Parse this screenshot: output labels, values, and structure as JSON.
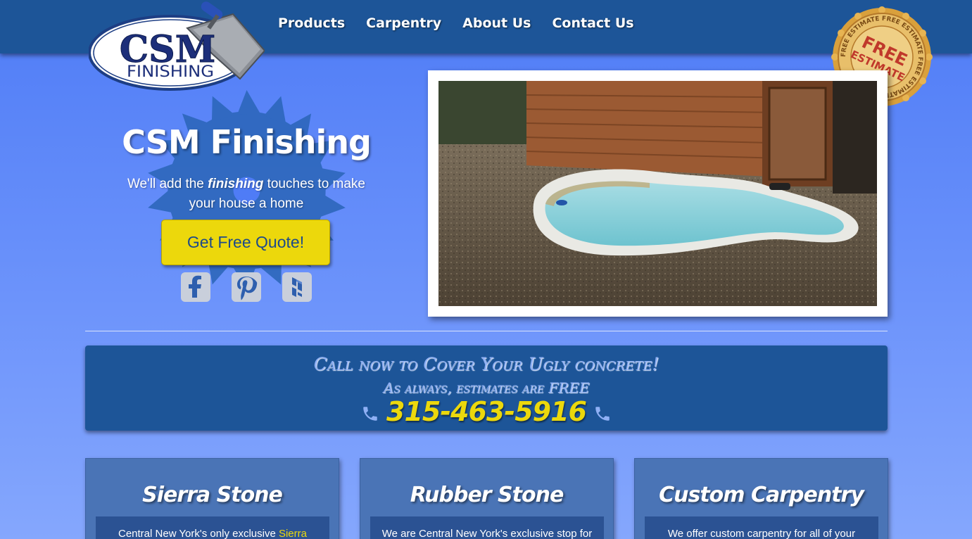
{
  "nav": {
    "items": [
      {
        "label": "Products"
      },
      {
        "label": "Carpentry"
      },
      {
        "label": "About Us"
      },
      {
        "label": "Contact Us"
      }
    ]
  },
  "logo": {
    "line1": "CSM",
    "line2": "FINISHING",
    "icon": "trowel-icon"
  },
  "seal": {
    "main": "FREE",
    "main2": "ESTIMATE",
    "ring_text": "FREE ESTIMATE FREE ESTIMATE FREE ESTIMATE"
  },
  "hero": {
    "title": "CSM Finishing",
    "subtitle_pre": "We'll add the ",
    "subtitle_em": "finishing",
    "subtitle_post": " touches to make your house a home",
    "cta_label": "Get Free Quote!",
    "social": [
      {
        "icon": "facebook-icon"
      },
      {
        "icon": "pinterest-icon"
      },
      {
        "icon": "houzz-icon"
      }
    ]
  },
  "photo": {
    "subject": "hot-tub-photo"
  },
  "banner": {
    "line1": "Call now to Cover Your Ugly concrete!",
    "line2": "As always, estimates are FREE",
    "phone": "315-463-5916",
    "icon": "phone-icon"
  },
  "cards": [
    {
      "title": "Sierra Stone",
      "body_pre": "Central New York's only exclusive ",
      "body_hl": "Sierra",
      "body_post": ""
    },
    {
      "title": "Rubber Stone",
      "body_pre": "We are Central New York's exclusive stop for",
      "body_hl": "",
      "body_post": ""
    },
    {
      "title": "Custom Carpentry",
      "body_pre": "We offer custom carpentry for all of your",
      "body_hl": "",
      "body_post": ""
    }
  ],
  "colors": {
    "nav_bg": "#1d5598",
    "accent_yellow": "#ecd80c",
    "page_bg": "#5a86f8"
  }
}
